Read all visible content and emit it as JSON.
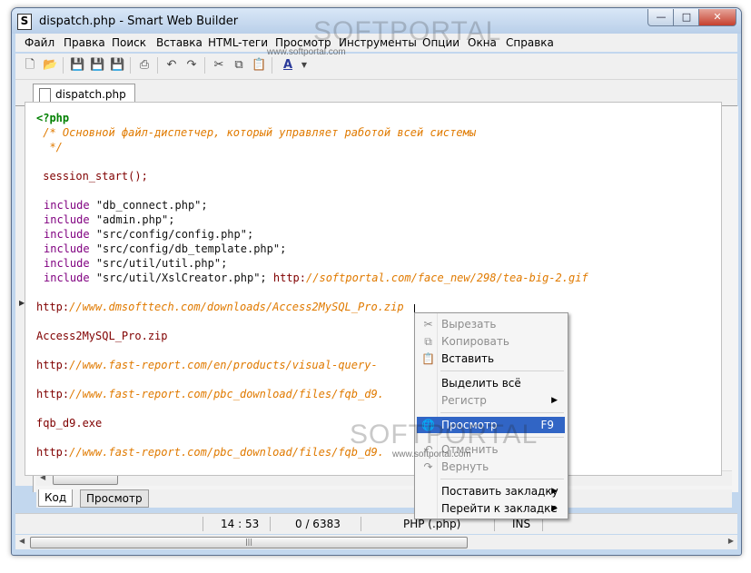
{
  "window": {
    "title": "dispatch.php - Smart Web Builder",
    "controls": [
      "minimize",
      "maximize",
      "close"
    ]
  },
  "menu": [
    "Файл",
    "Правка",
    "Поиск",
    "Вставка",
    "HTML-теги",
    "Просмотр",
    "Инструменты",
    "Опции",
    "Окна",
    "Справка"
  ],
  "toolbar_icons": [
    "new-file-icon",
    "open-folder-icon",
    "save-icon",
    "save-as-icon",
    "save-all-icon",
    "print-icon",
    "undo-icon",
    "redo-icon",
    "cut-icon",
    "copy-icon",
    "paste-icon",
    "font-icon",
    "dropdown-arrow-icon"
  ],
  "doc_tab": "dispatch.php",
  "code": {
    "open_tag": "<?php",
    "comment1": " /* Основной файл-диспетчер, который управляет работой всей системы",
    "comment2": "  */",
    "session": " session_start();",
    "inc_kw": "include",
    "inc1": "\"db_connect.php\";",
    "inc2": "\"admin.php\";",
    "inc3": "\"src/config/config.php\";",
    "inc4": "\"src/config/db_template.php\";",
    "inc5": "\"src/util/util.php\";",
    "inc6": "\"src/util/XslCreator.php\";",
    "inc6_http": " http:",
    "inc6_url": "//softportal.com/face_new/298/tea-big-2.gif",
    "l1_http": "http:",
    "l1_url": "//www.dmsofttech.com/downloads/Access2MySQL_Pro.zip",
    "l2": "Access2MySQL_Pro.zip",
    "l3_http": "http:",
    "l3_url": "//www.fast-report.com/en/products/visual-query-",
    "l4_http": "http:",
    "l4_url": "//www.fast-report.com/pbc_download/files/fqb_d9.",
    "l5": "fqb_d9.exe",
    "l6_http": "http:",
    "l6_url": "//www.fast-report.com/pbc_download/files/fqb_d9."
  },
  "bottom_tabs": {
    "code": "Код",
    "preview": "Просмотр"
  },
  "status": {
    "position": "14 : 53",
    "chars": "0 / 6383",
    "mode": "PHP (.php)",
    "insert": "INS"
  },
  "context_menu": {
    "cut": "Вырезать",
    "copy": "Копировать",
    "paste": "Вставить",
    "select_all": "Выделить всё",
    "case": "Регистр",
    "preview": "Просмотр",
    "preview_shortcut": "F9",
    "undo": "Отменить",
    "redo": "Вернуть",
    "set_bookmark": "Поставить закладку",
    "goto_bookmark": "Перейти к закладке"
  },
  "watermark": {
    "brand": "SOFTPORTAL",
    "url": "www.softportal.com"
  }
}
